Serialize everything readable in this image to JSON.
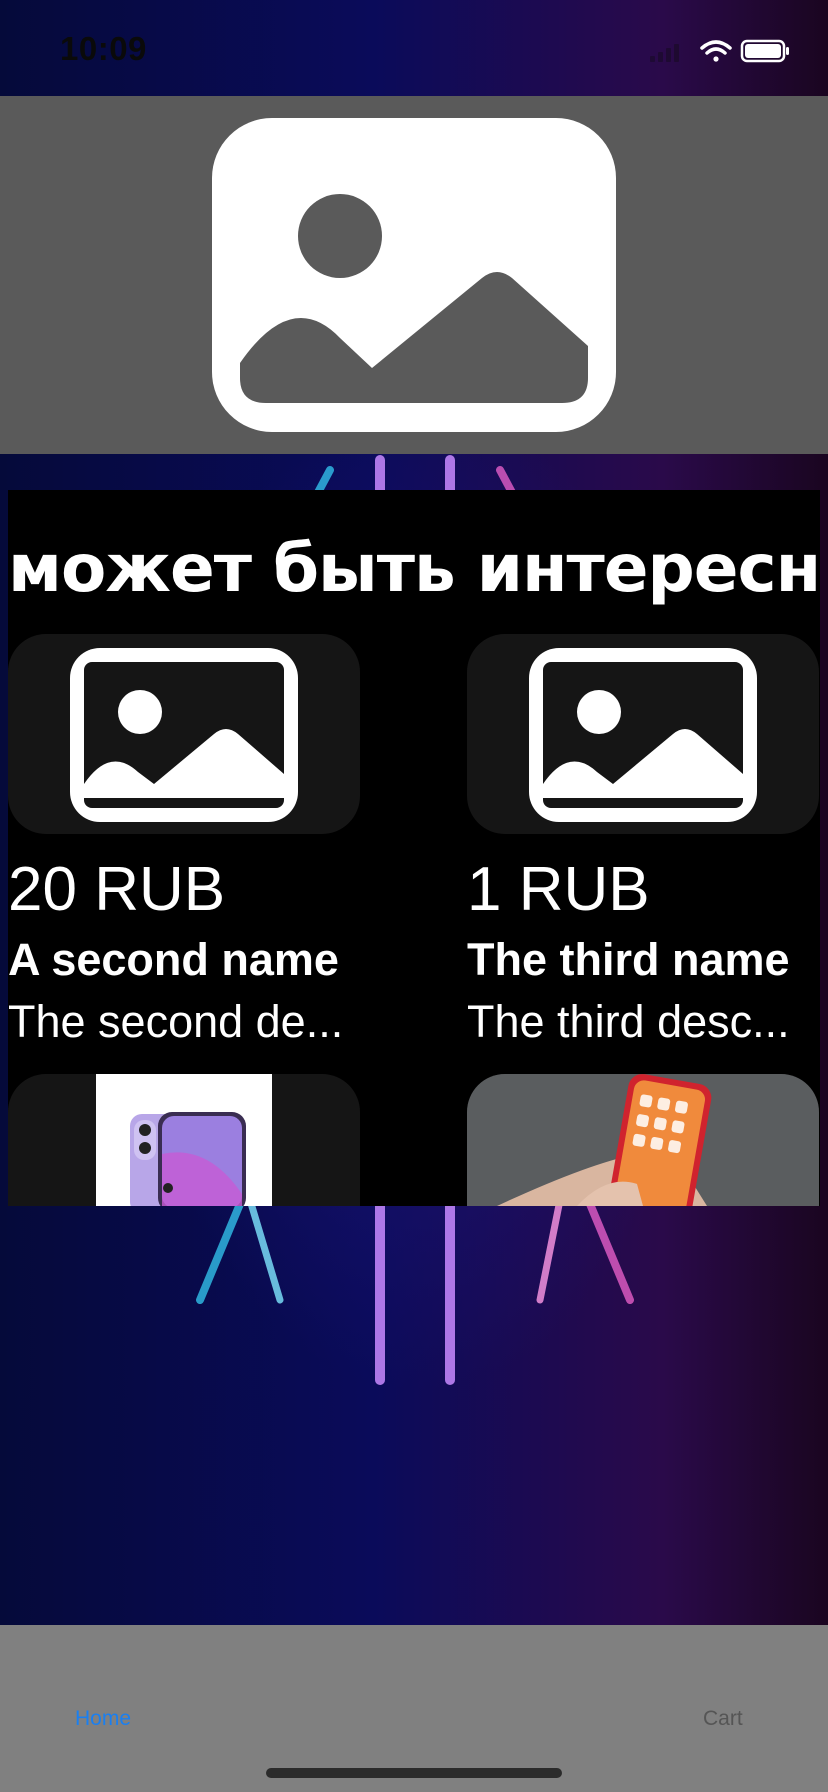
{
  "status_bar": {
    "time": "10:09"
  },
  "section": {
    "title": "может быть интересно"
  },
  "products": [
    {
      "price": "20 RUB",
      "name": "A second name",
      "description": "The second de..."
    },
    {
      "price": "1 RUB",
      "name": "The third name",
      "description": "The third desc..."
    }
  ],
  "tab_bar": {
    "home_label": "Home",
    "cart_label": "Cart"
  },
  "colors": {
    "accent": "#1a7ff0",
    "hero_bg": "#5a5a5a",
    "panel_bg": "#000000",
    "tab_bar_bg": "#808080"
  },
  "icons": [
    "wifi-icon",
    "battery-icon",
    "photo-placeholder-icon"
  ]
}
